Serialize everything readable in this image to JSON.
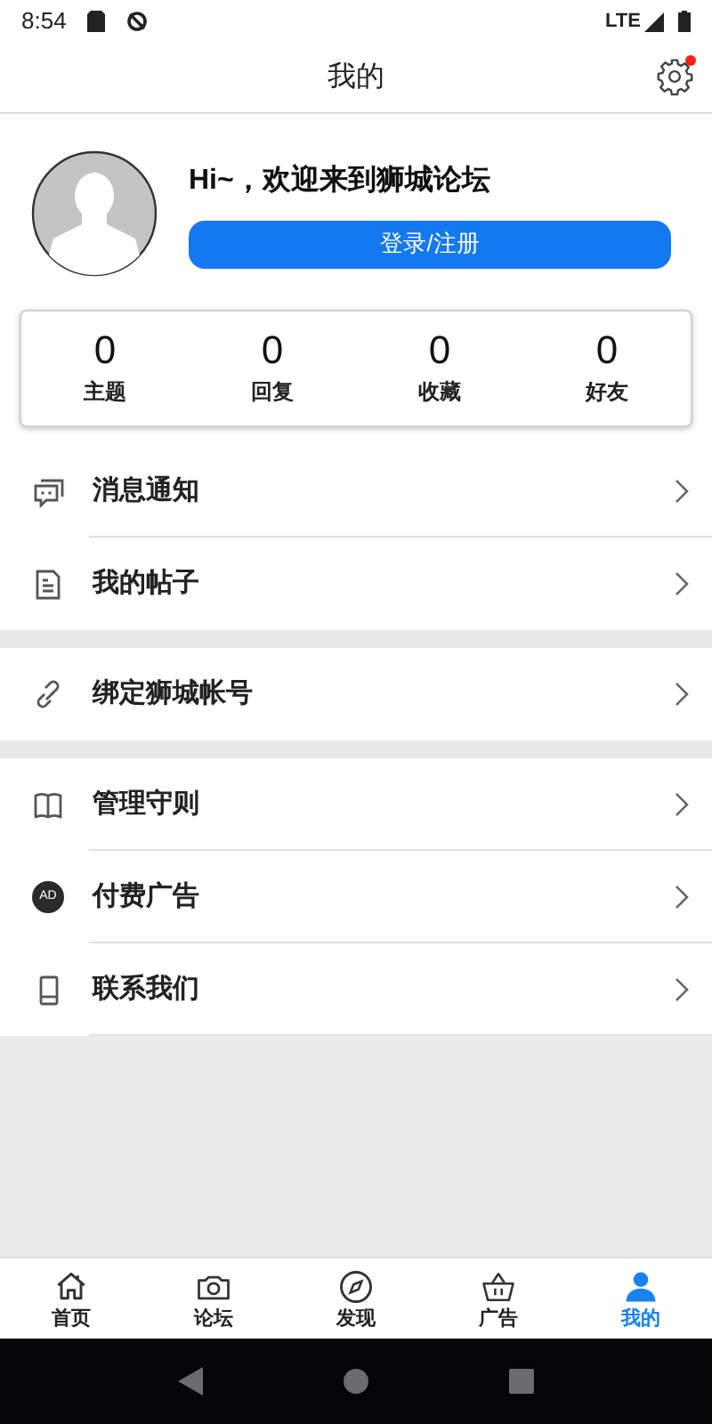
{
  "status_bar": {
    "time": "8:54",
    "network": "LTE"
  },
  "header": {
    "title": "我的",
    "settings_badge": true
  },
  "profile": {
    "greeting": "Hi~，欢迎来到狮城论坛",
    "login_button": "登录/注册"
  },
  "stats": [
    {
      "value": "0",
      "label": "主题"
    },
    {
      "value": "0",
      "label": "回复"
    },
    {
      "value": "0",
      "label": "收藏"
    },
    {
      "value": "0",
      "label": "好友"
    }
  ],
  "menu_groups": [
    [
      {
        "kind": "message",
        "label": "消息通知"
      },
      {
        "kind": "document",
        "label": "我的帖子"
      }
    ],
    [
      {
        "kind": "link",
        "label": "绑定狮城帐号"
      }
    ],
    [
      {
        "kind": "book",
        "label": "管理守则"
      },
      {
        "kind": "ad",
        "label": "付费广告",
        "icon_text": "AD"
      },
      {
        "kind": "phone",
        "label": "联系我们"
      }
    ]
  ],
  "tabs": [
    {
      "kind": "home",
      "label": "首页",
      "selected": false
    },
    {
      "kind": "camera",
      "label": "论坛",
      "selected": false
    },
    {
      "kind": "compass",
      "label": "发现",
      "selected": false
    },
    {
      "kind": "basket",
      "label": "广告",
      "selected": false
    },
    {
      "kind": "person",
      "label": "我的",
      "selected": true
    }
  ]
}
